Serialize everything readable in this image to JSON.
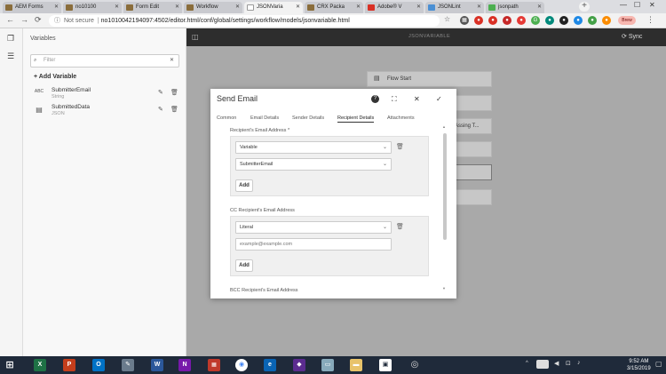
{
  "browser": {
    "tabs": [
      {
        "label": "AEM Forms",
        "color": "#8a6d3b"
      },
      {
        "label": "no10100",
        "color": "#8a6d3b"
      },
      {
        "label": "Form Edit",
        "color": "#8a6d3b"
      },
      {
        "label": "Workflow",
        "color": "#8a6d3b"
      },
      {
        "label": "JSONVaria",
        "color": "#ffffff",
        "active": true
      },
      {
        "label": "CRX Packa",
        "color": "#8a6d3b"
      },
      {
        "label": "Adobe® V",
        "color": "#d93025"
      },
      {
        "label": "JSONLint",
        "color": "#4a8fd4"
      },
      {
        "label": "jsonpath",
        "color": "#4caf50"
      }
    ],
    "security": "Not secure",
    "url": "no1010042194097:4502/editor.html/conf/global/settings/workflow/models/jsonvariable.html",
    "profile": "Brew"
  },
  "variables_panel": {
    "title": "Variables",
    "filter_placeholder": "Filter",
    "add_label": "Add Variable",
    "items": [
      {
        "type_badge": "ABC",
        "name": "SubmitterEmail",
        "type": "String"
      },
      {
        "type_badge": "▤",
        "name": "SubmittedData",
        "type": "JSON"
      }
    ]
  },
  "editor": {
    "title": "JSONVARIABLE",
    "sync_label": "Sync",
    "nodes": [
      {
        "label": "Flow Start"
      },
      {
        "label": ""
      },
      {
        "label": "(Assing T..."
      },
      {
        "label": ""
      },
      {
        "label": ""
      },
      {
        "label": ""
      }
    ]
  },
  "dialog": {
    "title": "Send Email",
    "tabs": [
      {
        "label": "Common"
      },
      {
        "label": "Email Details"
      },
      {
        "label": "Sender Details"
      },
      {
        "label": "Recipient Details",
        "active": true
      },
      {
        "label": "Attachments"
      }
    ],
    "recipient": {
      "label": "Recipient's Email Address *",
      "mode": "Variable",
      "value": "SubmitterEmail",
      "add_label": "Add"
    },
    "cc": {
      "label": "CC Recipient's Email Address",
      "mode": "Literal",
      "placeholder": "example@example.com",
      "add_label": "Add"
    },
    "bcc": {
      "label": "BCC Recipient's Email Address"
    }
  },
  "taskbar": {
    "time": "9:52 AM",
    "date": "3/15/2019"
  }
}
